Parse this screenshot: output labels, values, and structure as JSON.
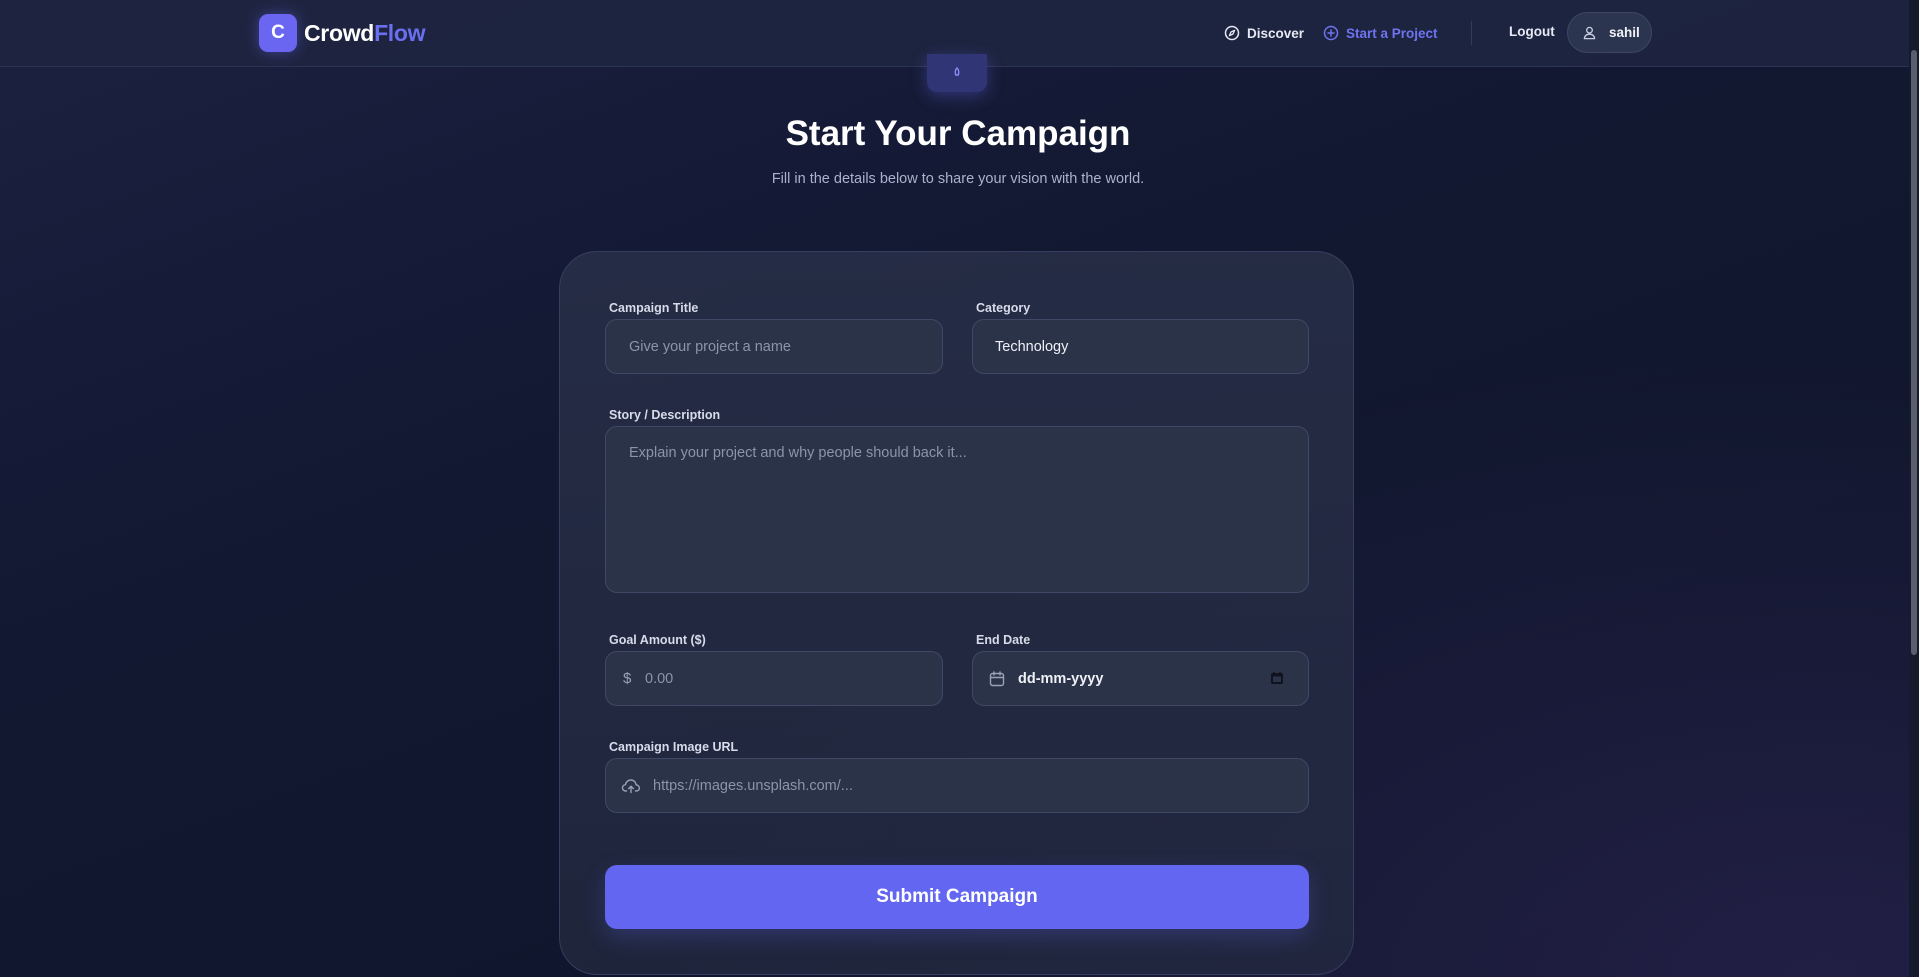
{
  "brand": {
    "logo_letter": "C",
    "name_part1": "Crowd",
    "name_part2": "Flow"
  },
  "nav": {
    "discover_label": "Discover",
    "start_project_label": "Start a Project",
    "logout_label": "Logout",
    "username": "sahil"
  },
  "page": {
    "title": "Start Your Campaign",
    "subtitle": "Fill in the details below to share your vision with the world."
  },
  "form": {
    "title_label": "Campaign Title",
    "title_placeholder": "Give your project a name",
    "category_label": "Category",
    "category_value": "Technology",
    "story_label": "Story / Description",
    "story_placeholder": "Explain your project and why people should back it...",
    "goal_label": "Goal Amount ($)",
    "goal_currency_symbol": "$",
    "goal_placeholder": "0.00",
    "end_date_label": "End Date",
    "end_date_placeholder": "dd-mm-yyyy",
    "image_url_label": "Campaign Image URL",
    "image_url_placeholder": "https://images.unsplash.com/...",
    "submit_label": "Submit Campaign"
  },
  "icons": {
    "discover": "compass-icon",
    "start_project": "plus-circle-icon",
    "user": "user-icon",
    "end_date": "calendar-icon",
    "image_url": "cloud-upload-icon"
  },
  "colors": {
    "accent": "#6366f1",
    "accent_link": "#6f73f2",
    "background": "#121831",
    "card": "#282f48",
    "field": "#2b3348"
  }
}
